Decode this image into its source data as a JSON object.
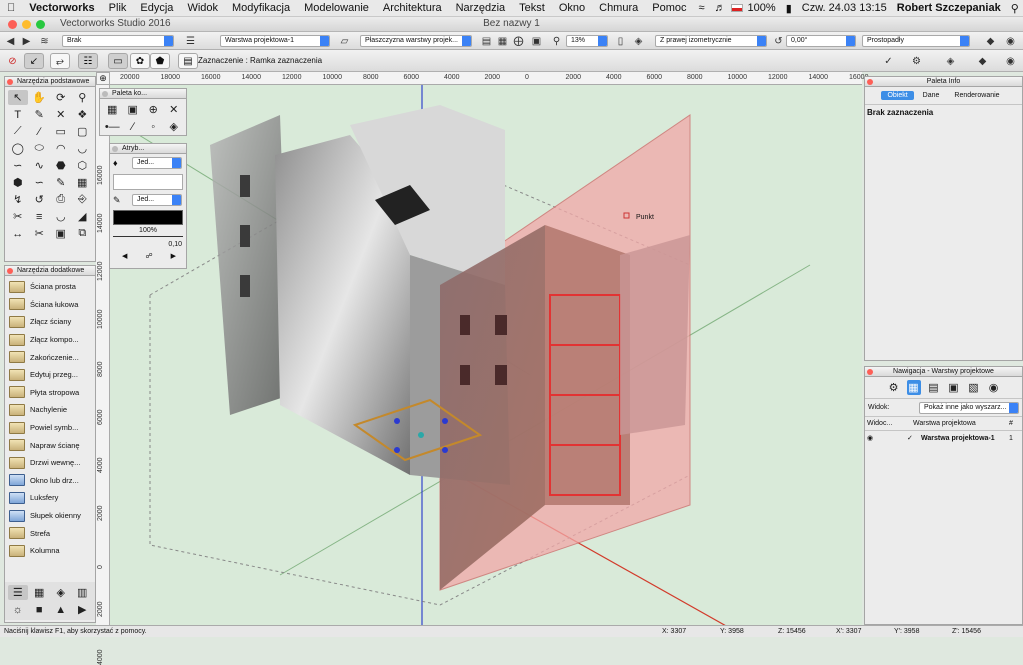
{
  "menubar": {
    "app": "Vectorworks",
    "items": [
      "Plik",
      "Edycja",
      "Widok",
      "Modyfikacja",
      "Modelowanie",
      "Architektura",
      "Narzędzia",
      "Tekst",
      "Okno",
      "Chmura",
      "Pomoc"
    ],
    "battery": "100%",
    "datetime": "Czw. 24.03  13:15",
    "user": "Robert Szczepaniak"
  },
  "window": {
    "app_title": "Vectorworks Studio 2016",
    "doc_title": "Bez nazwy 1"
  },
  "toolbar1": {
    "class_select": "Brak",
    "layer_select": "Warstwa projektowa-1",
    "plane_select": "Płaszczyzna warstwy projek...",
    "zoom": "13%",
    "view_select": "Z prawej izometrycznie",
    "rotation": "0,00°",
    "projection": "Prostopadły"
  },
  "toolbar2": {
    "mode_label": "Zaznaczenie : Ramka zaznaczenia"
  },
  "ruler": {
    "h": [
      "20000",
      "18000",
      "16000",
      "14000",
      "12000",
      "10000",
      "8000",
      "6000",
      "4000",
      "2000",
      "0",
      "2000",
      "4000",
      "6000",
      "8000",
      "10000",
      "12000",
      "14000",
      "16000"
    ],
    "v": [
      "16000",
      "14000",
      "12000",
      "10000",
      "8000",
      "6000",
      "4000",
      "2000",
      "0",
      "2000",
      "4000"
    ]
  },
  "basic_tools": {
    "title": "Narzędzia podstawowe"
  },
  "extra_tools": {
    "title": "Narzędzia dodatkowe",
    "items": [
      "Ściana prosta",
      "Ściana łukowa",
      "Złącz ściany",
      "Złącz kompo...",
      "Zakończenie...",
      "Edytuj przeg...",
      "Płyta stropowa",
      "Nachylenie",
      "Powiel symb...",
      "Napraw ścianę",
      "Drzwi wewnę...",
      "Okno lub drz...",
      "Luksfery",
      "Słupek okienny",
      "Strefa",
      "Kolumna"
    ]
  },
  "snap_palette": {
    "title": "Paleta ko..."
  },
  "attr_palette": {
    "title": "Atryb...",
    "fill": "Jed...",
    "pen": "Jed...",
    "opacity": "100%",
    "thickness": "0,10"
  },
  "canvas": {
    "point_label": "Punkt"
  },
  "info_palette": {
    "title": "Paleta Info",
    "tabs": [
      "Obiekt",
      "Dane",
      "Renderowanie"
    ],
    "status": "Brak zaznaczenia"
  },
  "nav_palette": {
    "title": "Nawigacja - Warstwy projektowe",
    "view_label": "Widok:",
    "view_value": "Pokaż inne jako wyszarz...",
    "columns": [
      "Widoc...",
      "Warstwa projektowa",
      "#"
    ],
    "rows": [
      {
        "name": "Warstwa projektowa-1",
        "num": "1"
      }
    ]
  },
  "status": {
    "help": "Naciśnij klawisz F1, aby skorzystać z pomocy.",
    "x": "X: 3307",
    "y": "Y: 3958",
    "z": "Z: 15456",
    "x2": "X': 3307",
    "y2": "Y': 3958",
    "z2": "Z': 15456"
  },
  "colors": {
    "accent": "#3d8ee6",
    "section_plane": "#f2a8a8",
    "canvas": "#d9ead9"
  }
}
